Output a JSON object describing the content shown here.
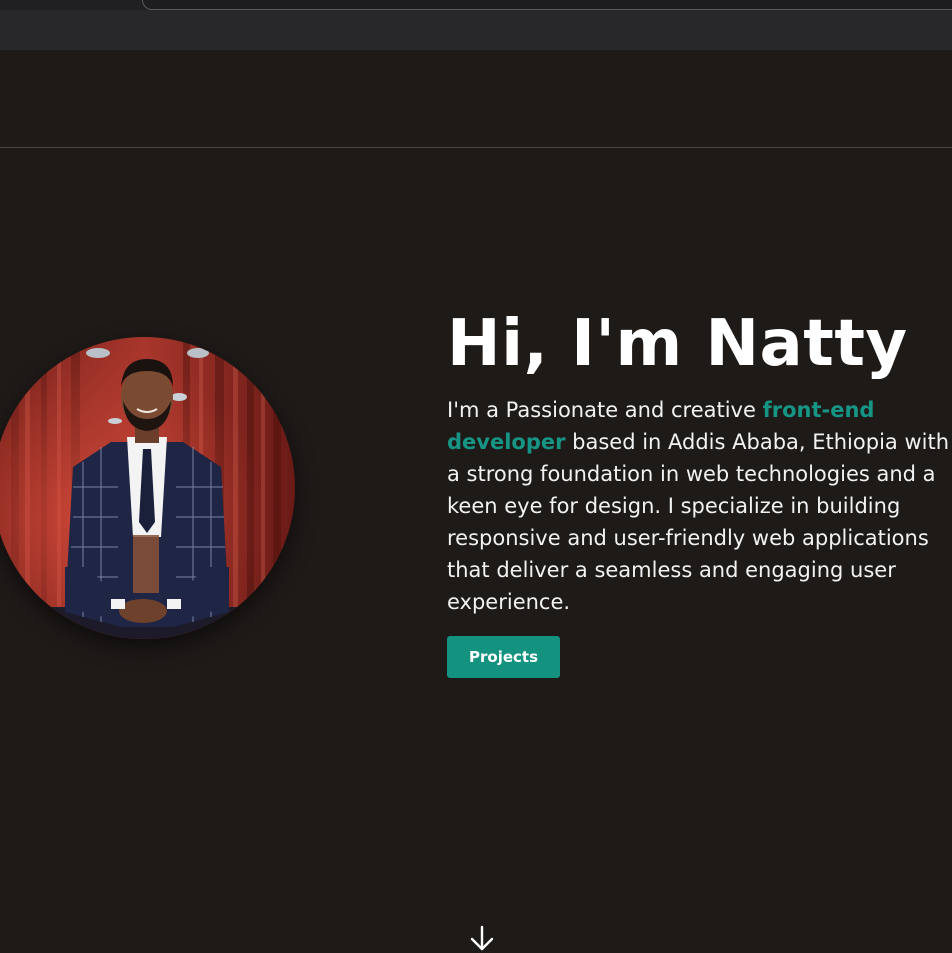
{
  "hero": {
    "greeting": "Hi, I'm Natty",
    "description_before": "I'm a Passionate and creative ",
    "description_accent": "front-end developer",
    "description_after": " based in Addis Ababa, Ethiopia with a strong foundation in web technologies and a keen eye for design. I specialize in building responsive and user-friendly web applications that deliver a seamless and engaging user experience.",
    "button_label": "Projects"
  },
  "colors": {
    "background": "#1e1a18",
    "accent": "#169585",
    "button": "#13927f",
    "text": "#ffffff"
  },
  "icons": {
    "scroll": "arrow-down-icon"
  }
}
